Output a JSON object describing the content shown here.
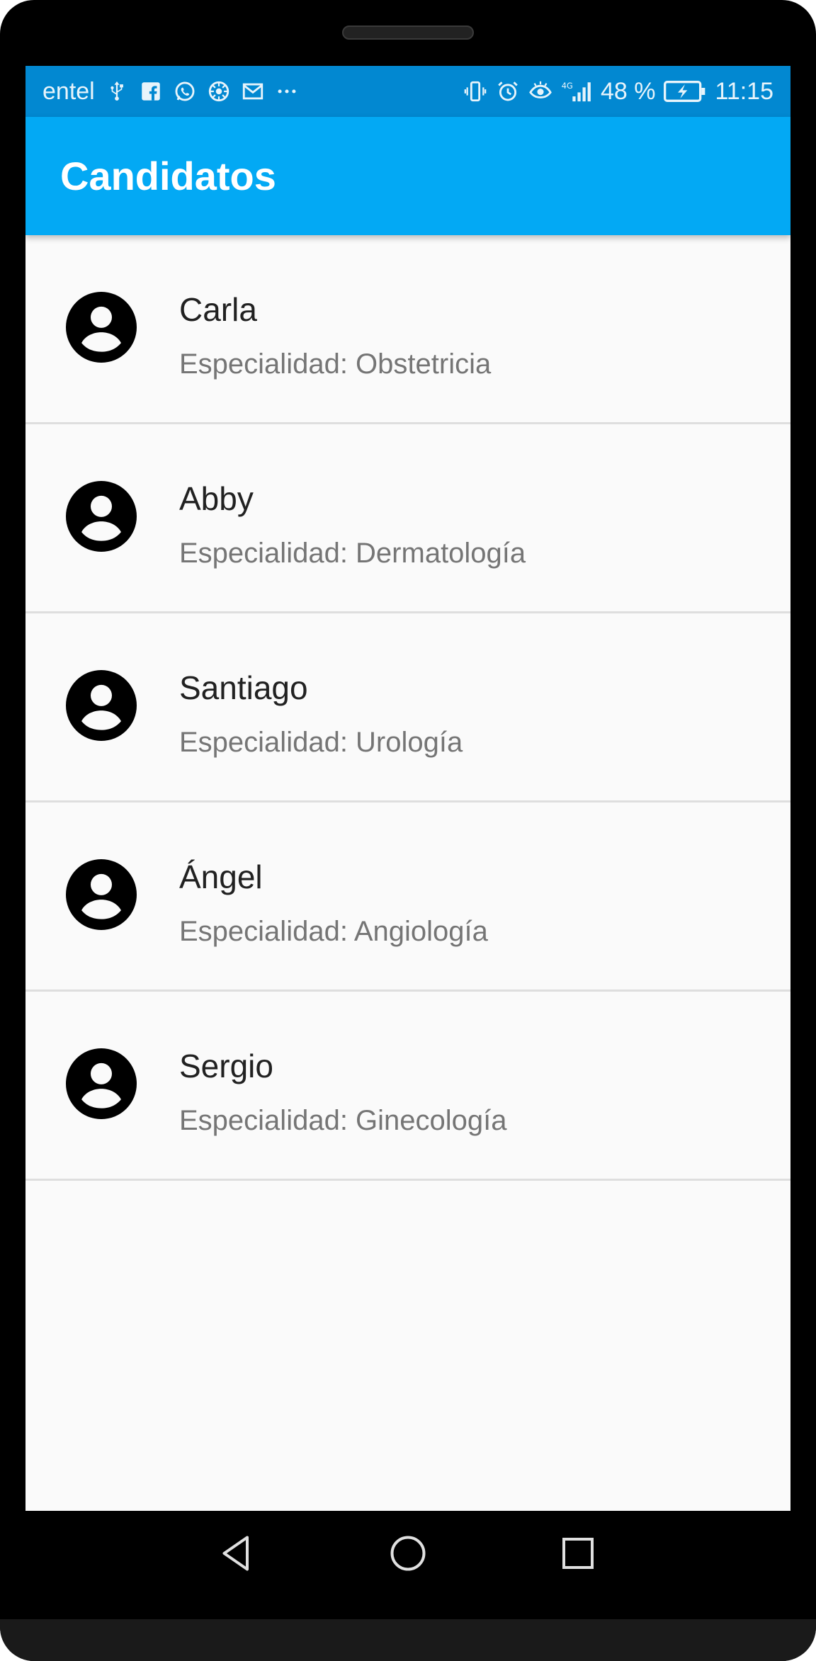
{
  "status_bar": {
    "carrier": "entel",
    "battery_percent": "48 %",
    "time": "11:15",
    "network": "4G",
    "left_icons": [
      "usb-icon",
      "facebook-icon",
      "whatsapp-icon",
      "settings-icon",
      "gmail-icon",
      "more-icon"
    ],
    "right_icons": [
      "vibrate-icon",
      "alarm-icon",
      "eye-comfort-icon",
      "signal-icon",
      "battery-icon"
    ]
  },
  "app_bar": {
    "title": "Candidatos",
    "color": "#03a9f4"
  },
  "candidates": [
    {
      "name": "Carla",
      "specialty": "Especialidad: Obstetricia"
    },
    {
      "name": "Abby",
      "specialty": "Especialidad: Dermatología"
    },
    {
      "name": "Santiago",
      "specialty": "Especialidad: Urología"
    },
    {
      "name": "Ángel",
      "specialty": "Especialidad: Angiología"
    },
    {
      "name": "Sergio",
      "specialty": "Especialidad: Ginecología"
    }
  ],
  "nav_bar": {
    "buttons": [
      "back-icon",
      "home-icon",
      "recents-icon"
    ]
  }
}
